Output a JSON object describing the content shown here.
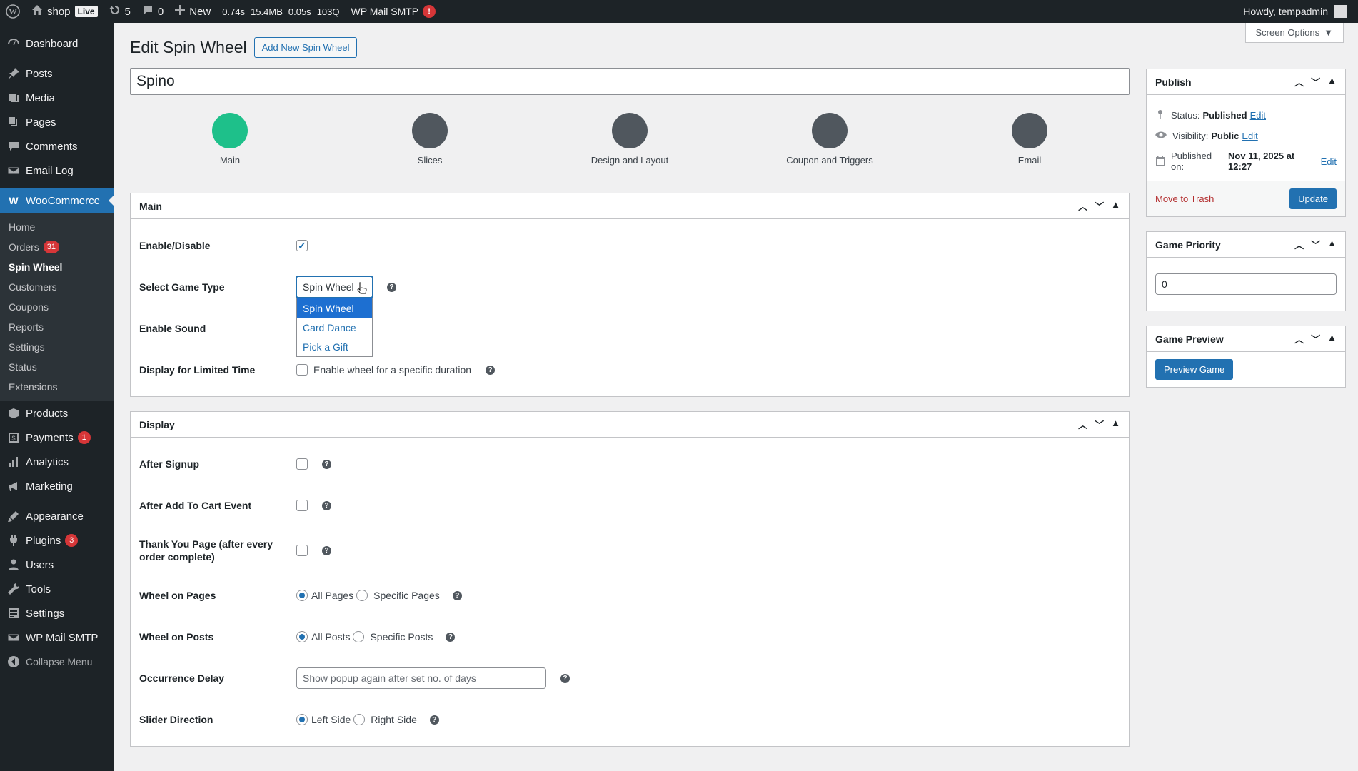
{
  "adminbar": {
    "site_name": "shop",
    "live_label": "Live",
    "updates_count": "5",
    "comments_count": "0",
    "new_label": "New",
    "perf": [
      "0.74s",
      "15.4MB",
      "0.05s",
      "103Q"
    ],
    "smtp_label": "WP Mail SMTP",
    "smtp_alert": "!",
    "howdy": "Howdy, tempadmin"
  },
  "sidebar": {
    "top": [
      {
        "label": "Dashboard",
        "icon": "dashboard-icon"
      }
    ],
    "group1": [
      {
        "label": "Posts",
        "icon": "pin-icon"
      },
      {
        "label": "Media",
        "icon": "media-icon"
      },
      {
        "label": "Pages",
        "icon": "pages-icon"
      },
      {
        "label": "Comments",
        "icon": "comment-icon"
      },
      {
        "label": "Email Log",
        "icon": "email-icon"
      }
    ],
    "woocommerce": {
      "label": "WooCommerce",
      "icon": "woocommerce-icon"
    },
    "woo_sub": [
      {
        "label": "Home"
      },
      {
        "label": "Orders",
        "badge": "31"
      },
      {
        "label": "Spin Wheel"
      },
      {
        "label": "Customers"
      },
      {
        "label": "Coupons"
      },
      {
        "label": "Reports"
      },
      {
        "label": "Settings"
      },
      {
        "label": "Status"
      },
      {
        "label": "Extensions"
      }
    ],
    "group2": [
      {
        "label": "Products",
        "icon": "products-icon"
      },
      {
        "label": "Payments",
        "icon": "payments-icon",
        "badge": "1"
      },
      {
        "label": "Analytics",
        "icon": "analytics-icon"
      },
      {
        "label": "Marketing",
        "icon": "marketing-icon"
      }
    ],
    "group3": [
      {
        "label": "Appearance",
        "icon": "appearance-icon"
      },
      {
        "label": "Plugins",
        "icon": "plugins-icon",
        "badge": "3"
      },
      {
        "label": "Users",
        "icon": "users-icon"
      },
      {
        "label": "Tools",
        "icon": "tools-icon"
      },
      {
        "label": "Settings",
        "icon": "settings-icon"
      },
      {
        "label": "WP Mail SMTP",
        "icon": "mail-icon"
      },
      {
        "label": "Collapse Menu",
        "icon": "collapse-icon"
      }
    ]
  },
  "screen_options": "Screen Options",
  "page": {
    "title": "Edit Spin Wheel",
    "add_new": "Add New Spin Wheel",
    "post_title": "Spino"
  },
  "steps": [
    {
      "label": "Main",
      "done": true
    },
    {
      "label": "Slices"
    },
    {
      "label": "Design and Layout"
    },
    {
      "label": "Coupon and Triggers"
    },
    {
      "label": "Email"
    }
  ],
  "main_panel": {
    "title": "Main",
    "enable_label": "Enable/Disable",
    "game_type_label": "Select Game Type",
    "game_type_value": "Spin Wheel",
    "game_type_options": [
      "Spin Wheel",
      "Card Dance",
      "Pick a Gift"
    ],
    "sound_label": "Enable Sound",
    "limited_label": "Display for Limited Time",
    "limited_text": "Enable wheel for a specific duration"
  },
  "display_panel": {
    "title": "Display",
    "after_signup": "After Signup",
    "after_cart": "After Add To Cart Event",
    "thank_you": "Thank You Page (after every order complete)",
    "wheel_pages": "Wheel on Pages",
    "all_pages": "All Pages",
    "specific_pages": "Specific Pages",
    "wheel_posts": "Wheel on Posts",
    "all_posts": "All Posts",
    "specific_posts": "Specific Posts",
    "occurrence": "Occurrence Delay",
    "occurrence_placeholder": "Show popup again after set no. of days",
    "slider": "Slider Direction",
    "left_side": "Left Side",
    "right_side": "Right Side"
  },
  "publish": {
    "title": "Publish",
    "status_label": "Status:",
    "status_value": "Published",
    "visibility_label": "Visibility:",
    "visibility_value": "Public",
    "published_label": "Published on:",
    "published_value": "Nov 11, 2025 at 12:27",
    "edit": "Edit",
    "trash": "Move to Trash",
    "update": "Update"
  },
  "priority": {
    "title": "Game Priority",
    "value": "0"
  },
  "preview": {
    "title": "Game Preview",
    "button": "Preview Game"
  }
}
